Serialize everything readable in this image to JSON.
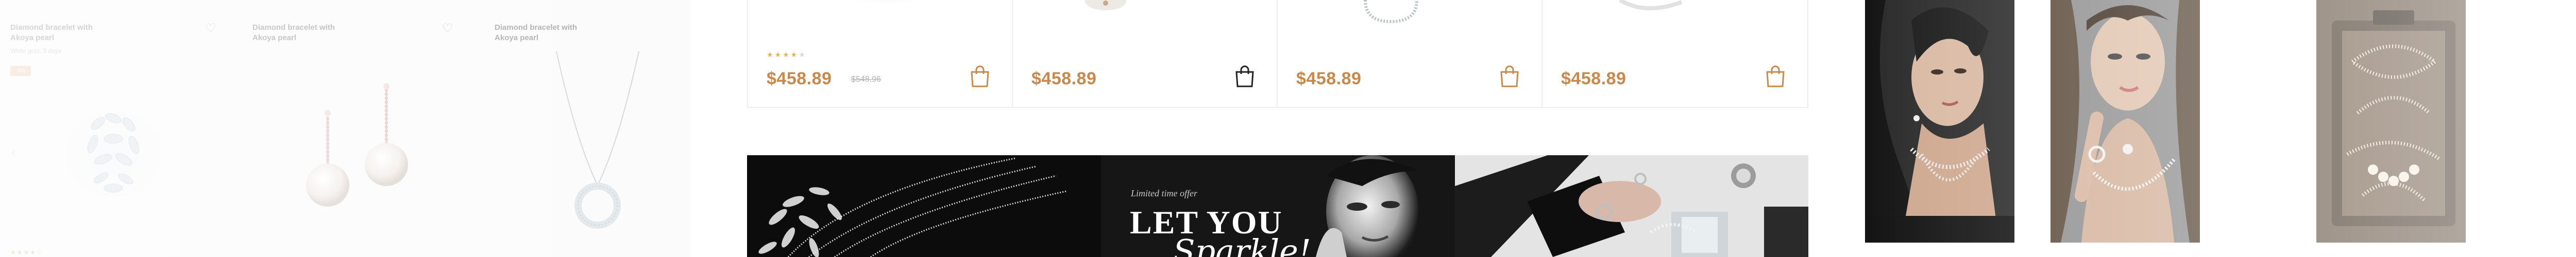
{
  "left_grid": {
    "products": [
      {
        "name": "Diamond bracelet with Akoya pearl",
        "subtitle": "White gold, 3 days",
        "badge": "-5%",
        "heart": "heart-icon"
      },
      {
        "name": "Diamond bracelet with Akoya pearl",
        "heart": "heart-icon"
      },
      {
        "name": "Diamond bracelet with Akoya pearl",
        "heart": "heart-icon"
      }
    ],
    "arrow": "‹",
    "stars": "★★★★☆"
  },
  "products": [
    {
      "price": "$458.89",
      "old_price": "$548.96",
      "stars": "★★★★",
      "stars_dim": "★",
      "cart_icon": "shopping-bag-icon"
    },
    {
      "price": "$458.89",
      "cart_icon": "shopping-bag-icon"
    },
    {
      "price": "$458.89",
      "cart_icon": "shopping-bag-icon"
    },
    {
      "price": "$458.89",
      "cart_icon": "shopping-bag-icon"
    }
  ],
  "banner": {
    "kicker": "Limited time offer",
    "title": "LET YOU",
    "script": "Sparkle!"
  },
  "colors": {
    "accent": "#c8894d",
    "star": "#e6b35b",
    "border": "#eeeeee",
    "banner_dark": "#0c0c0c"
  }
}
